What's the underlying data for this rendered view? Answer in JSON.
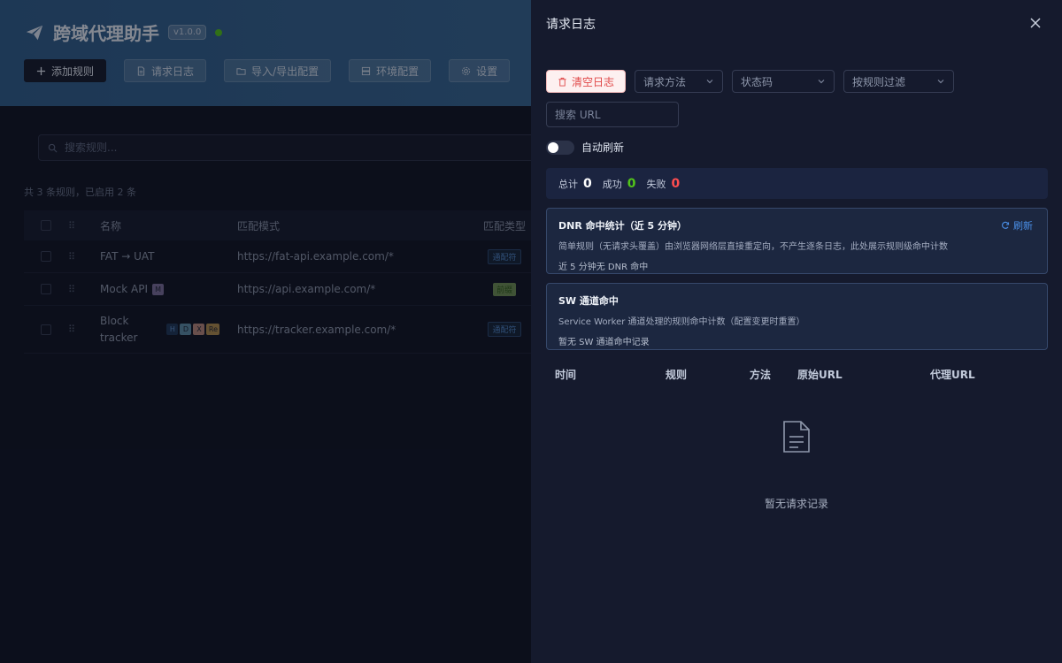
{
  "app": {
    "title": "跨域代理助手",
    "version": "v1.0.0",
    "status_color": "#52c41a",
    "toolbar": {
      "add_rule": "添加规则",
      "request_log": "请求日志",
      "import_export": "导入/导出配置",
      "env_config": "环境配置",
      "settings": "设置"
    },
    "search": {
      "placeholder": "搜索规则..."
    },
    "summary": "共 3 条规则，已启用 2 条",
    "table": {
      "headers": {
        "name": "名称",
        "pattern": "匹配模式",
        "type": "匹配类型"
      },
      "rows": [
        {
          "name": "FAT → UAT",
          "pattern": "https://fat-api.example.com/*",
          "type": "通配符",
          "badges": []
        },
        {
          "name": "Mock API",
          "pattern": "https://api.example.com/*",
          "type": "前缀",
          "badges": [
            "M"
          ]
        },
        {
          "name_line1": "Block",
          "name_line2": "tracker",
          "pattern": "https://tracker.example.com/*",
          "type": "通配符",
          "badges": [
            "H",
            "D",
            "X",
            "Re"
          ]
        }
      ]
    }
  },
  "drawer": {
    "title": "请求日志",
    "clear_button": "清空日志",
    "filters": {
      "method": "请求方法",
      "status": "状态码",
      "rule": "按规则过滤"
    },
    "url_search": {
      "placeholder": "搜索 URL"
    },
    "auto_refresh": {
      "label": "自动刷新",
      "enabled": false
    },
    "stats": {
      "total_label": "总计",
      "total": "0",
      "success_label": "成功",
      "success": "0",
      "fail_label": "失败",
      "fail": "0"
    },
    "dnr_card": {
      "title": "DNR 命中统计（近 5 分钟）",
      "refresh": "刷新",
      "desc": "简单规则（无请求头覆盖）由浏览器网络层直接重定向，不产生逐条日志，此处展示规则级命中计数",
      "note": "近 5 分钟无 DNR 命中"
    },
    "sw_card": {
      "title": "SW 通道命中",
      "desc": "Service Worker 通道处理的规则命中计数（配置变更时重置）",
      "note": "暂无 SW 通道命中记录"
    },
    "log_table": {
      "headers": {
        "time": "时间",
        "rule": "规则",
        "method": "方法",
        "original_url": "原始URL",
        "proxy_url": "代理URL"
      },
      "empty_text": "暂无请求记录"
    }
  },
  "colors": {
    "header_bg": "#3c6c98",
    "drawer_bg": "#151a2d",
    "success": "#52c41a",
    "danger": "#ff4d4f",
    "link": "#4a8fe7"
  }
}
